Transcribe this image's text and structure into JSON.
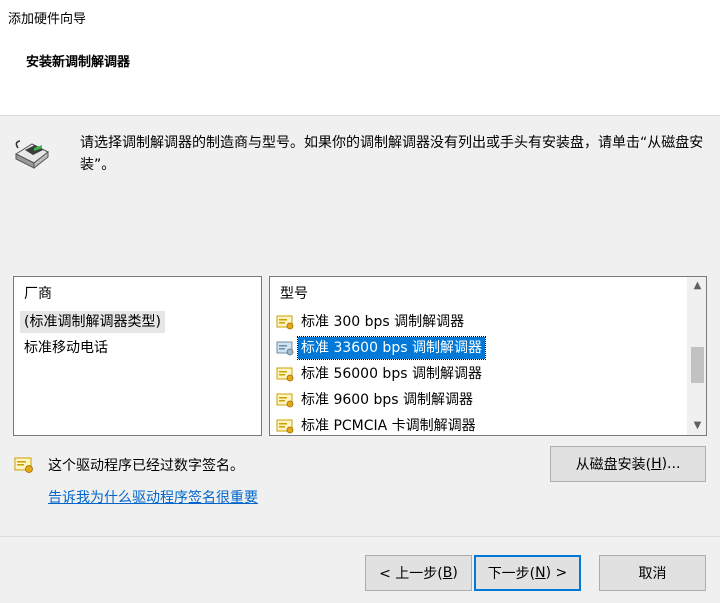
{
  "window": {
    "title": "添加硬件向导"
  },
  "wizard": {
    "heading": "安装新调制解调器"
  },
  "intro": {
    "icon": "modem-device-icon",
    "text": "请选择调制解调器的制造商与型号。如果你的调制解调器没有列出或手头有安装盘，请单击“从磁盘安装”。"
  },
  "manufacturers": {
    "header": "厂商",
    "items": [
      {
        "label": "(标准调制解调器类型)",
        "selected": true
      },
      {
        "label": "标准移动电话",
        "selected": false
      }
    ]
  },
  "models": {
    "header": "型号",
    "items": [
      {
        "label": "标准 300 bps 调制解调器",
        "icon": "modem-driver-icon",
        "selected": false
      },
      {
        "label": "标准 33600 bps 调制解调器",
        "icon": "modem-driver-icon",
        "selected": true
      },
      {
        "label": "标准 56000 bps 调制解调器",
        "icon": "modem-driver-icon",
        "selected": false
      },
      {
        "label": "标准 9600 bps 调制解调器",
        "icon": "modem-driver-icon",
        "selected": false
      },
      {
        "label": "标准 PCMCIA 卡调制解调器",
        "icon": "modem-driver-icon",
        "selected": false
      }
    ]
  },
  "signature": {
    "icon": "signed-driver-icon",
    "text": "这个驱动程序已经过数字签名。",
    "link": "告诉我为什么驱动程序签名很重要"
  },
  "buttons": {
    "have_disk": {
      "text": "从磁盘安装(",
      "mnemonic": "H",
      "suffix": ")..."
    },
    "back": {
      "text": "< 上一步(",
      "mnemonic": "B",
      "suffix": ")"
    },
    "next": {
      "text": "下一步(",
      "mnemonic": "N",
      "suffix": ") >"
    },
    "cancel": "取消"
  },
  "colors": {
    "selection": "#0078d7",
    "link": "#0066cc",
    "default_button_border": "#0078d7"
  }
}
